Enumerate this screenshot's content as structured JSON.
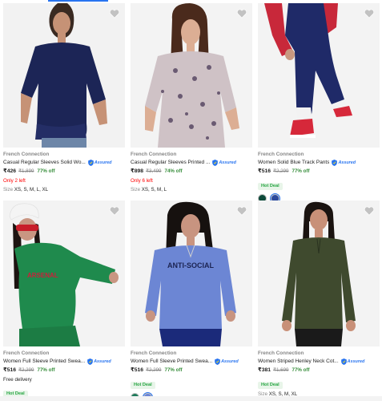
{
  "products": [
    {
      "brand": "French Connection",
      "title": "Casual Regular Sleeves Solid Wo...",
      "price": "₹426",
      "mrp": "₹1,899",
      "off": "77% off",
      "stock": "Only 2 left",
      "sizes_label": "Size",
      "sizes": "XS, S, M, L, XL",
      "assured": "Assured"
    },
    {
      "brand": "French Connection",
      "title": "Casual Regular Sleeves Printed ...",
      "price": "₹898",
      "mrp": "₹3,499",
      "off": "74% off",
      "stock": "Only 6 left",
      "sizes_label": "Size",
      "sizes": "XS, S, M, L",
      "assured": "Assured"
    },
    {
      "brand": "French Connection",
      "title": "Women Solid Blue Track Pants",
      "price": "₹516",
      "mrp": "₹2,299",
      "off": "77% off",
      "badge": "Hot Deal",
      "assured": "Assured",
      "swatches": [
        "#0d4a3a",
        "#2d4a9c"
      ]
    },
    {
      "brand": "French Connection",
      "title": "Women Full Sleeve Printed Swea...",
      "price": "₹516",
      "mrp": "₹2,299",
      "off": "77% off",
      "delivery": "Free delivery",
      "badge": "Hot Deal",
      "assured": "Assured"
    },
    {
      "brand": "French Connection",
      "title": "Women Full Sleeve Printed Swea...",
      "price": "₹516",
      "mrp": "₹2,299",
      "off": "77% off",
      "badge": "Hot Deal",
      "assured": "Assured",
      "swatches": [
        "#1e7a5a",
        "#6b85d6"
      ]
    },
    {
      "brand": "French Connection",
      "title": "Women Striped Henley Neck Cot...",
      "price": "₹381",
      "mrp": "₹1,699",
      "off": "77% off",
      "badge": "Hot Deal",
      "sizes_label": "Size",
      "sizes": "XS, S, M, XL",
      "assured": "Assured"
    }
  ],
  "colors": {
    "accent": "#2874f0",
    "discount": "#388e3c",
    "hot_deal": "#26a541",
    "low_stock": "#ff0000"
  },
  "icons": {
    "wishlist": "heart-icon",
    "assured": "shield-icon"
  }
}
